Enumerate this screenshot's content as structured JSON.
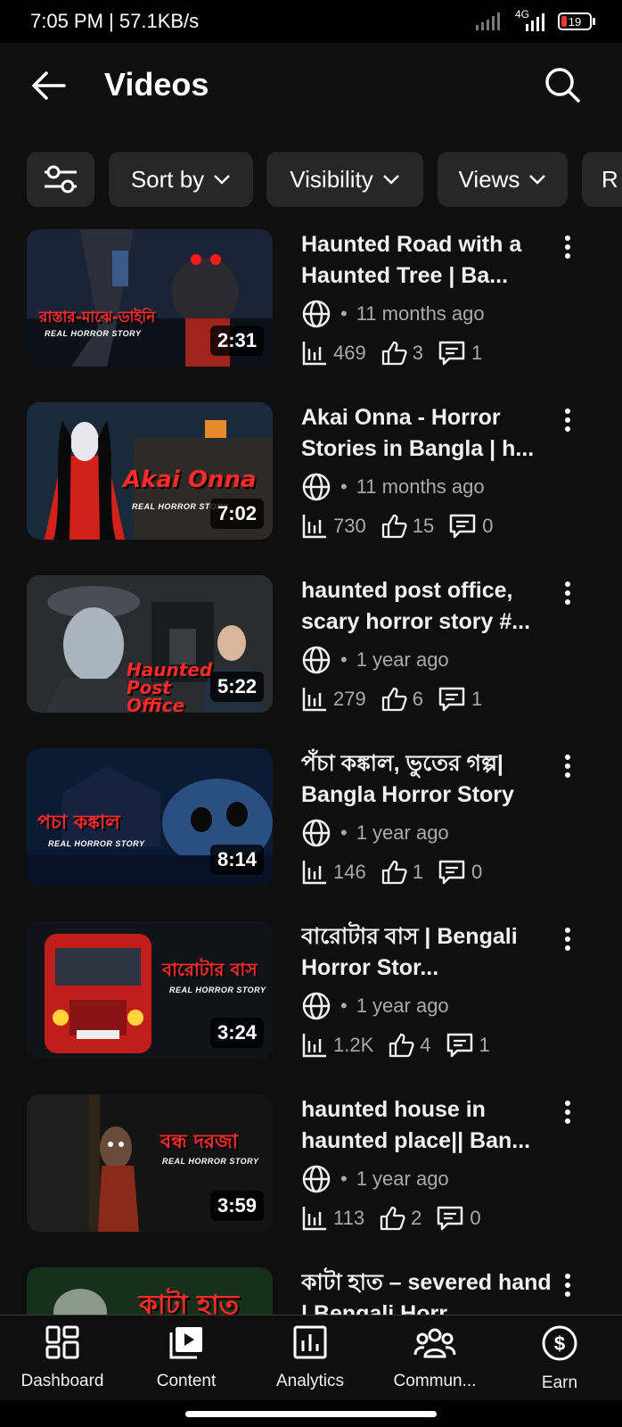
{
  "status": {
    "time": "7:05 PM | 57.1KB/s",
    "network": "4G",
    "battery": "19"
  },
  "header": {
    "title": "Videos"
  },
  "filters": [
    {
      "label": ""
    },
    {
      "label": "Sort by"
    },
    {
      "label": "Visibility"
    },
    {
      "label": "Views"
    },
    {
      "label": "R"
    }
  ],
  "videos": [
    {
      "title": "Haunted Road with a Haunted Tree | Ba...",
      "age": "11 months ago",
      "views": "469",
      "likes": "3",
      "comments": "1",
      "duration": "2:31",
      "thumb_text": "রাস্তার-মাঝে-ডাইনি",
      "thumb_sub": "REAL HORROR STORY"
    },
    {
      "title": "Akai Onna  - Horror Stories in Bangla | h...",
      "age": "11 months ago",
      "views": "730",
      "likes": "15",
      "comments": "0",
      "duration": "7:02",
      "thumb_text": "Akai Onna",
      "thumb_sub": "REAL HORROR STORY"
    },
    {
      "title": "haunted post office, scary horror story #...",
      "age": "1 year ago",
      "views": "279",
      "likes": "6",
      "comments": "1",
      "duration": "5:22",
      "thumb_text": "Haunted Post Office",
      "thumb_sub": ""
    },
    {
      "title": "পঁচা কঙ্কাল, ভুতের গল্প| Bangla Horror Story",
      "age": "1 year ago",
      "views": "146",
      "likes": "1",
      "comments": "0",
      "duration": "8:14",
      "thumb_text": "পচা কঙ্কাল",
      "thumb_sub": "REAL HORROR STORY"
    },
    {
      "title": "বারোটার বাস | Bengali Horror Stor...",
      "age": "1 year ago",
      "views": "1.2K",
      "likes": "4",
      "comments": "1",
      "duration": "3:24",
      "thumb_text": "বারোটার বাস",
      "thumb_sub": "REAL HORROR STORY"
    },
    {
      "title": "haunted house in haunted place|| Ban...",
      "age": "1 year ago",
      "views": "113",
      "likes": "2",
      "comments": "0",
      "duration": "3:59",
      "thumb_text": "বন্ধ দরজা",
      "thumb_sub": "REAL HORROR STORY"
    },
    {
      "title": "কাটা হাত – severed hand | Bengali Horr...",
      "age": "",
      "views": "",
      "likes": "",
      "comments": "",
      "duration": "",
      "thumb_text": "কাটা হাত",
      "thumb_sub": ""
    }
  ],
  "nav": [
    {
      "label": "Dashboard",
      "icon": "dashboard-icon"
    },
    {
      "label": "Content",
      "icon": "content-icon"
    },
    {
      "label": "Analytics",
      "icon": "analytics-icon"
    },
    {
      "label": "Commun...",
      "icon": "community-icon"
    },
    {
      "label": "Earn",
      "icon": "earn-icon"
    }
  ],
  "colors": {
    "background": "#0f0f0f",
    "chip": "#272727",
    "accent_red": "#ff2a2a",
    "battery_low": "#e53935"
  }
}
